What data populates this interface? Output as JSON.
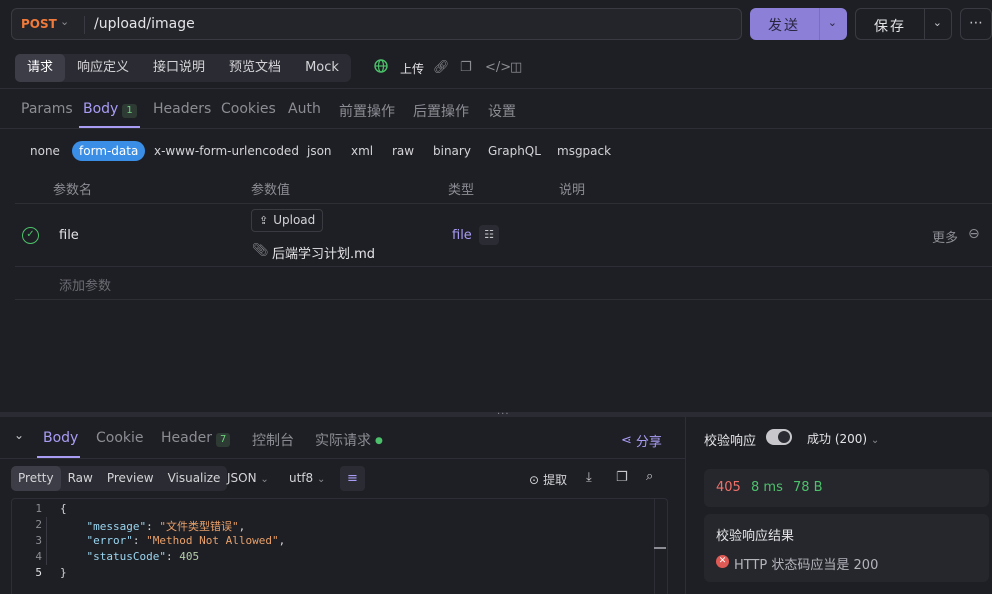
{
  "request": {
    "method": "POST",
    "url": "/upload/image",
    "send_label": "发送",
    "save_label": "保存"
  },
  "mode_tabs": [
    "请求",
    "响应定义",
    "接口说明",
    "预览文档",
    "Mock"
  ],
  "upload_label": "上传",
  "param_tabs": {
    "params": "Params",
    "body": "Body",
    "body_count": "1",
    "headers": "Headers",
    "cookies": "Cookies",
    "auth": "Auth",
    "pre": "前置操作",
    "post": "后置操作",
    "settings": "设置"
  },
  "body_types": [
    "none",
    "form-data",
    "x-www-form-urlencoded",
    "json",
    "xml",
    "raw",
    "binary",
    "GraphQL",
    "msgpack"
  ],
  "table": {
    "headers": [
      "参数名",
      "参数值",
      "类型",
      "说明"
    ],
    "row": {
      "name": "file",
      "upload_label": "Upload",
      "filename": "后端学习计划.md",
      "type": "file",
      "more": "更多"
    },
    "add_param": "添加参数"
  },
  "response": {
    "tabs": {
      "body": "Body",
      "cookie": "Cookie",
      "header": "Header",
      "header_count": "7",
      "console": "控制台",
      "actual": "实际请求"
    },
    "share": "分享",
    "view_modes": [
      "Pretty",
      "Raw",
      "Preview",
      "Visualize"
    ],
    "format": "JSON",
    "encoding": "utf8",
    "extract": "提取",
    "code_lines": [
      "1",
      "2",
      "3",
      "4",
      "5"
    ],
    "json": {
      "open": "{",
      "message_key": "\"message\"",
      "message_val": "\"文件类型错误\"",
      "error_key": "\"error\"",
      "error_val": "\"Method Not Allowed\"",
      "status_key": "\"statusCode\"",
      "status_val": "405",
      "close": "}"
    }
  },
  "validation": {
    "label": "校验响应",
    "status_select": "成功 (200)",
    "status_code": "405",
    "time": "8 ms",
    "size": "78 B",
    "result_title": "校验响应结果",
    "result_text": "HTTP 状态码应当是 200"
  },
  "colors": {
    "accent": "#a99cf5",
    "error": "#f0706a",
    "success": "#4cc06a"
  }
}
